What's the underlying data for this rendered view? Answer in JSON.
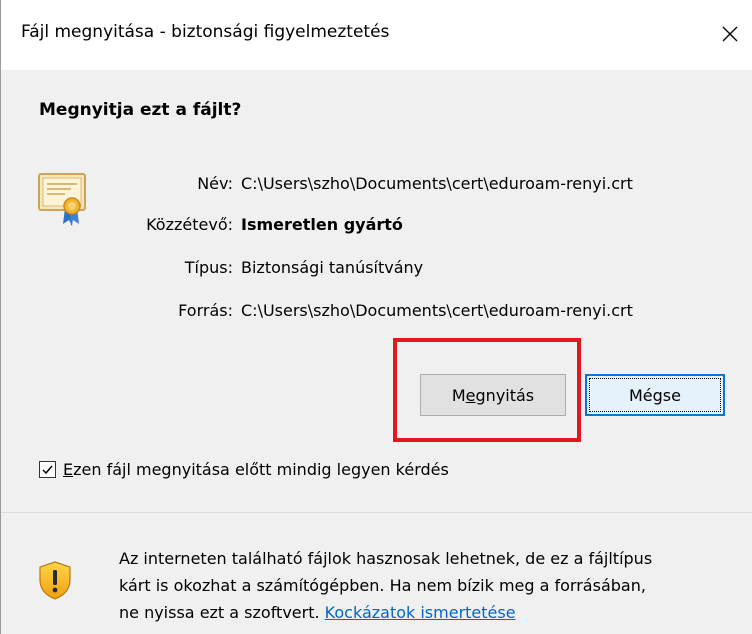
{
  "window": {
    "title": "Fájl megnyitása - biztonsági figyelmeztetés",
    "close_glyph": "×"
  },
  "heading": "Megnyitja ezt a fájlt?",
  "file_info": {
    "name_label": "Név:",
    "name_value": "C:\\Users\\szho\\Documents\\cert\\eduroam-renyi.crt",
    "publisher_label": "Közzétevő:",
    "publisher_value": "Ismeretlen gyártó",
    "type_label": "Típus:",
    "type_value": "Biztonsági tanúsítvány",
    "source_label": "Forrás:",
    "source_value": "C:\\Users\\szho\\Documents\\cert\\eduroam-renyi.crt",
    "icon": "certificate-icon"
  },
  "buttons": {
    "open_pre": "M",
    "open_accel": "e",
    "open_post": "gnyitás",
    "cancel": "Mégse"
  },
  "checkbox": {
    "checked": true,
    "accel": "E",
    "label_rest": "zen fájl megnyitása előtt mindig legyen kérdés"
  },
  "warning": {
    "icon": "shield-warning-icon",
    "line1": "Az interneten található fájlok hasznosak lehetnek, de ez a fájltípus",
    "line2": "kárt is okozhat a számítógépben. Ha nem bízik meg a forrásában,",
    "line3": "ne nyissa ezt a szoftvert.",
    "link": "Kockázatok ismertetése"
  },
  "colors": {
    "highlight": "#e3181f",
    "link": "#0066cc",
    "focus": "#0078d7"
  }
}
